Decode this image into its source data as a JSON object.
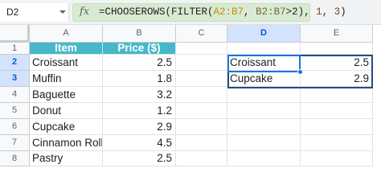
{
  "name_box": "D2",
  "formula_bar": {
    "fx_label": "fx",
    "formula_prefix": "=CHOOSEROWS(FILTER(",
    "range1": "A2:B7",
    "sep1": ", ",
    "range2": "B2:B7",
    "cond": ">2), ",
    "arg2": "1",
    "sep2": ", ",
    "arg3": "3",
    "close": ")"
  },
  "columns": [
    "A",
    "B",
    "C",
    "D",
    "E"
  ],
  "rows": [
    "1",
    "2",
    "3",
    "4",
    "5",
    "6",
    "7",
    "8"
  ],
  "table": {
    "header": {
      "item": "Item",
      "price": "Price ($)"
    },
    "rows": [
      {
        "item": "Croissant",
        "price": "2.5"
      },
      {
        "item": "Muffin",
        "price": "1.8"
      },
      {
        "item": "Baguette",
        "price": "3.2"
      },
      {
        "item": "Donut",
        "price": "1.2"
      },
      {
        "item": "Cupcake",
        "price": "2.9"
      },
      {
        "item": "Cinnamon Roll",
        "price": "4.5"
      },
      {
        "item": "Pastry",
        "price": "2.5"
      }
    ]
  },
  "result": [
    {
      "item": "Croissant",
      "price": "2.5"
    },
    {
      "item": "Cupcake",
      "price": "2.9"
    }
  ],
  "colors": {
    "header_fill": "#47b8c8",
    "selection": "#1a73e8",
    "fx_highlight": "#d9ead3"
  }
}
